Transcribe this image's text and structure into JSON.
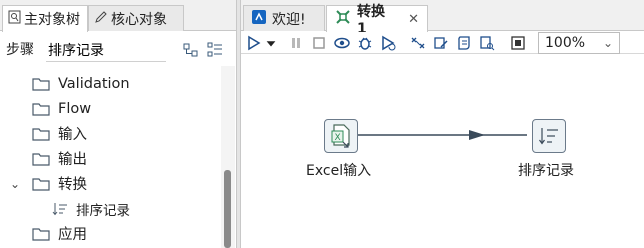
{
  "left_panel": {
    "tabs": [
      {
        "label": "主对象树",
        "icon": "object-tree-icon"
      },
      {
        "label": "核心对象",
        "icon": "pencil-icon"
      }
    ],
    "search": {
      "label": "步骤",
      "value": "排序记录"
    },
    "toolbar_icons": [
      "collapse-tree-icon",
      "expand-tree-icon"
    ],
    "tree": [
      {
        "label": "Validation",
        "type": "folder"
      },
      {
        "label": "Flow",
        "type": "folder"
      },
      {
        "label": "输入",
        "type": "folder"
      },
      {
        "label": "输出",
        "type": "folder"
      },
      {
        "label": "转换",
        "type": "folder",
        "expanded": true
      },
      {
        "label": "排序记录",
        "type": "step"
      },
      {
        "label": "应用",
        "type": "folder"
      }
    ]
  },
  "editor": {
    "tabs": [
      {
        "label": "欢迎!",
        "icon": "spoon-icon",
        "active": false
      },
      {
        "label": "转换 1",
        "icon": "transformation-icon",
        "active": true,
        "close": "✕"
      }
    ],
    "toolbar": {
      "buttons": [
        "run-icon",
        "run-dropdown-icon",
        "pause-icon",
        "stop-icon",
        "preview-icon",
        "debug-icon",
        "replay-icon",
        "verify-icon",
        "impact-icon",
        "sql-icon",
        "explore-db-icon",
        "show-results-icon"
      ],
      "zoom": "100%"
    },
    "canvas": {
      "steps": [
        {
          "name": "Excel输入",
          "icon": "excel-input-icon"
        },
        {
          "name": "排序记录",
          "icon": "sort-rows-icon"
        }
      ],
      "hops": [
        {
          "from": "Excel输入",
          "to": "排序记录"
        }
      ]
    }
  },
  "colors": {
    "accent": "#1565c0",
    "hop": "#3a4a5a",
    "folder": "#4a5a6a",
    "icon_green": "#2e8b57"
  }
}
